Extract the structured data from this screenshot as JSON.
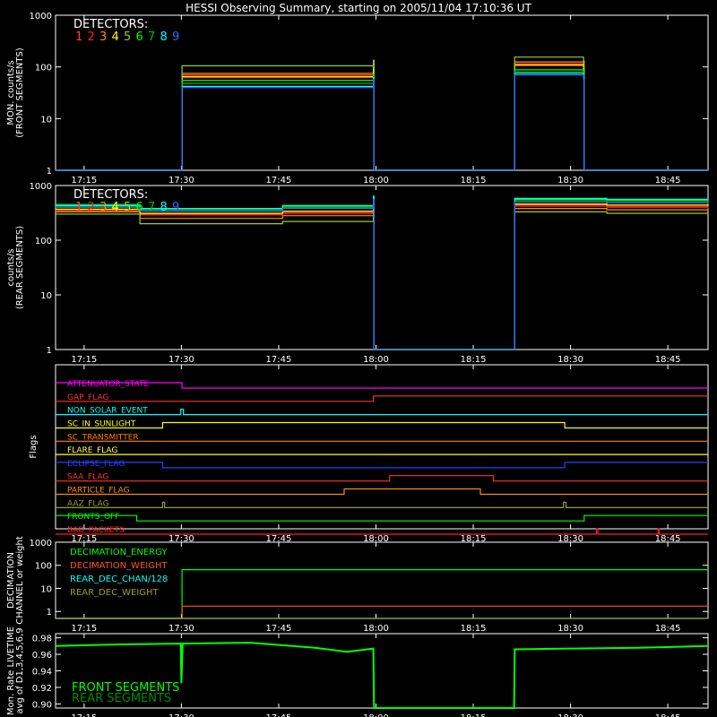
{
  "title": "HESSI Observing Summary, starting on 2005/11/04 17:10:36 UT",
  "time_ticks": [
    "17:15",
    "17:30",
    "17:45",
    "18:00",
    "18:15",
    "18:30",
    "18:45"
  ],
  "time_tick_minutes": [
    4.4,
    19.4,
    34.4,
    49.4,
    64.4,
    79.4,
    94.4
  ],
  "time_range_minutes": [
    0,
    100.6
  ],
  "detector_legend": {
    "label": "DETECTORS:",
    "numbers": [
      "1",
      "2",
      "3",
      "4",
      "5",
      "6",
      "7",
      "8",
      "9"
    ],
    "colors": [
      "#ff4040",
      "#ff2020",
      "#ff8c00",
      "#ffff00",
      "#9acd32",
      "#00ff00",
      "#00c000",
      "#00ffff",
      "#4060ff"
    ]
  },
  "chart_data": [
    {
      "type": "line",
      "panel": "front",
      "ylabel_lines": [
        "MON. counts/s",
        "(FRONT SEGMENTS)"
      ],
      "y_scale": "log",
      "ylim": [
        1,
        1000
      ],
      "yticks": [
        1,
        10,
        100,
        1000
      ],
      "ytick_labels": [
        "1",
        "10",
        "100",
        "1000"
      ],
      "x_minutes": [
        0,
        19.4,
        19.5,
        49.0,
        49.1,
        70.7,
        70.8,
        81.4,
        81.5,
        100.6
      ],
      "series": [
        {
          "name": "1",
          "color": "#ff4040",
          "values": [
            1,
            1,
            70,
            95,
            1,
            1,
            115,
            90,
            1,
            1
          ]
        },
        {
          "name": "2",
          "color": "#ff2020",
          "values": [
            1,
            1,
            62,
            88,
            1,
            1,
            105,
            85,
            1,
            1
          ]
        },
        {
          "name": "3",
          "color": "#ff8c00",
          "values": [
            1,
            1,
            75,
            100,
            1,
            1,
            125,
            95,
            1,
            1
          ]
        },
        {
          "name": "4",
          "color": "#ffff00",
          "values": [
            1,
            1,
            65,
            90,
            1,
            1,
            110,
            88,
            1,
            1
          ]
        },
        {
          "name": "5",
          "color": "#9acd32",
          "values": [
            1,
            1,
            105,
            135,
            1,
            1,
            155,
            130,
            1,
            1
          ]
        },
        {
          "name": "6",
          "color": "#00ff00",
          "values": [
            1,
            1,
            55,
            72,
            1,
            1,
            88,
            72,
            1,
            1
          ]
        },
        {
          "name": "7",
          "color": "#00c000",
          "values": [
            1,
            1,
            48,
            65,
            1,
            1,
            80,
            66,
            1,
            1
          ]
        },
        {
          "name": "8",
          "color": "#00ffff",
          "values": [
            1,
            1,
            42,
            62,
            1,
            1,
            75,
            62,
            1,
            1
          ]
        },
        {
          "name": "9",
          "color": "#4060ff",
          "values": [
            1,
            1,
            40,
            58,
            1,
            1,
            70,
            58,
            1,
            1
          ]
        }
      ]
    },
    {
      "type": "line",
      "panel": "rear",
      "ylabel_lines": [
        "counts/s",
        "(REAR SEGMENTS)"
      ],
      "y_scale": "log",
      "ylim": [
        1,
        1000
      ],
      "yticks": [
        1,
        10,
        100,
        1000
      ],
      "ytick_labels": [
        "1",
        "10",
        "100",
        "1000"
      ],
      "x_minutes": [
        0,
        13.0,
        35.0,
        49.0,
        49.1,
        70.7,
        70.8,
        85.0,
        100.6
      ],
      "series": [
        {
          "name": "1",
          "color": "#ff4040",
          "values": [
            360,
            300,
            320,
            480,
            1,
            1,
            440,
            420,
            400
          ]
        },
        {
          "name": "2",
          "color": "#ff2020",
          "values": [
            340,
            290,
            310,
            460,
            1,
            1,
            420,
            400,
            380
          ]
        },
        {
          "name": "3",
          "color": "#ff8c00",
          "values": [
            330,
            250,
            280,
            420,
            1,
            1,
            380,
            360,
            350
          ]
        },
        {
          "name": "4",
          "color": "#ffff00",
          "values": [
            370,
            310,
            340,
            500,
            1,
            1,
            460,
            440,
            420
          ]
        },
        {
          "name": "5",
          "color": "#9acd32",
          "values": [
            300,
            200,
            220,
            330,
            1,
            1,
            330,
            310,
            300
          ]
        },
        {
          "name": "6",
          "color": "#00ff00",
          "values": [
            450,
            380,
            420,
            620,
            1,
            1,
            560,
            540,
            520
          ]
        },
        {
          "name": "7",
          "color": "#00c000",
          "values": [
            420,
            360,
            400,
            600,
            1,
            1,
            530,
            510,
            500
          ]
        },
        {
          "name": "8",
          "color": "#00ffff",
          "values": [
            430,
            380,
            430,
            640,
            1,
            1,
            580,
            560,
            540
          ]
        },
        {
          "name": "9",
          "color": "#4060ff",
          "values": [
            400,
            340,
            380,
            560,
            1,
            1,
            500,
            480,
            460
          ]
        }
      ]
    },
    {
      "type": "flags",
      "panel": "flags",
      "ylabel": "Flags",
      "flags": [
        {
          "label": "ATTENUATOR_STATE",
          "color": "#ff00ff",
          "states": [
            [
              0,
              1
            ],
            [
              19.5,
              0
            ]
          ]
        },
        {
          "label": "GAP_FLAG",
          "color": "#ff3030",
          "states": [
            [
              0,
              0
            ],
            [
              49.0,
              1
            ]
          ]
        },
        {
          "label": "NON_SOLAR_EVENT",
          "color": "#00ffff",
          "states": [
            [
              0,
              0
            ],
            [
              19.3,
              1
            ],
            [
              19.7,
              0
            ]
          ]
        },
        {
          "label": "SC_IN_SUNLIGHT",
          "color": "#ffff00",
          "states": [
            [
              0,
              0
            ],
            [
              16.5,
              1
            ],
            [
              78.5,
              0
            ]
          ]
        },
        {
          "label": "SC_TRANSMITTER",
          "color": "#ff7f00",
          "states": [
            [
              0,
              0
            ]
          ]
        },
        {
          "label": "FLARE_FLAG",
          "color": "#ffff40",
          "states": [
            [
              0,
              0
            ]
          ]
        },
        {
          "label": "ECLIPSE_FLAG",
          "color": "#2040ff",
          "states": [
            [
              0,
              1
            ],
            [
              16.5,
              0
            ],
            [
              78.5,
              1
            ]
          ]
        },
        {
          "label": "SAA_FLAG",
          "color": "#ff3030",
          "states": [
            [
              0,
              0
            ],
            [
              51.5,
              1
            ],
            [
              67.5,
              0
            ]
          ]
        },
        {
          "label": "PARTICLE_FLAG",
          "color": "#ff8c00",
          "states": [
            [
              0,
              0
            ],
            [
              44.5,
              1
            ],
            [
              65.5,
              0
            ]
          ]
        },
        {
          "label": "AAZ_FLAG",
          "color": "#9a9a30",
          "states": [
            [
              0,
              0
            ],
            [
              16.5,
              1
            ],
            [
              16.8,
              0
            ],
            [
              78.3,
              1
            ],
            [
              78.7,
              0
            ]
          ]
        },
        {
          "label": "FRONTS_OFF",
          "color": "#00ff00",
          "states": [
            [
              0,
              1
            ],
            [
              12.5,
              0
            ],
            [
              81.5,
              1
            ]
          ]
        },
        {
          "label": "BAD_PACKETS",
          "color": "#ff2020",
          "states": [
            [
              0,
              0
            ],
            [
              83.4,
              1
            ],
            [
              83.6,
              0
            ],
            [
              92.9,
              1
            ],
            [
              93.1,
              0
            ]
          ]
        }
      ]
    },
    {
      "type": "line",
      "panel": "decimation",
      "ylabel_lines": [
        "DECIMATION",
        "CHANNEL or weight"
      ],
      "y_scale": "log",
      "ylim": [
        0.5,
        1000
      ],
      "yticks": [
        1,
        10,
        100,
        1000
      ],
      "ytick_labels": [
        "1",
        "10",
        "100",
        "1000"
      ],
      "legend": [
        {
          "name": "DECIMATION_ENERGY",
          "color": "#00ff00"
        },
        {
          "name": "DECIMATION_WEIGHT",
          "color": "#ff5030"
        },
        {
          "name": "REAR_DEC_CHAN/128",
          "color": "#00ffff"
        },
        {
          "name": "REAR_DEC_WEIGHT",
          "color": "#9a9a30"
        }
      ],
      "x_minutes": [
        0,
        19.4,
        19.5,
        100.6
      ],
      "series": [
        {
          "name": "DECIMATION_ENERGY",
          "color": "#00ff00",
          "values": [
            0.5,
            0.5,
            65,
            65
          ]
        },
        {
          "name": "DECIMATION_WEIGHT",
          "color": "#ff5030",
          "values": [
            0.5,
            0.5,
            1.7,
            1.7
          ]
        },
        {
          "name": "REAR_DEC_CHAN/128",
          "color": "#00ffff",
          "values": [
            0.5,
            0.5,
            0.5,
            0.5
          ]
        },
        {
          "name": "REAR_DEC_WEIGHT",
          "color": "#9a9a30",
          "values": [
            0.5,
            0.5,
            0.5,
            0.5
          ]
        }
      ]
    },
    {
      "type": "line",
      "panel": "livetime",
      "ylabel_lines": [
        "Mon. Rate LIVETIME",
        "avg of D1,3,4,5,6,9"
      ],
      "y_scale": "linear",
      "ylim": [
        0.895,
        0.985
      ],
      "yticks": [
        0.9,
        0.92,
        0.94,
        0.96,
        0.98
      ],
      "ytick_labels": [
        "0.90",
        "0.92",
        "0.94",
        "0.96",
        "0.98"
      ],
      "legend": [
        {
          "name": "FRONT SEGMENTS",
          "color": "#00ff00"
        },
        {
          "name": "REAR SEGMENTS",
          "color": "#008c00"
        }
      ],
      "x_minutes": [
        0,
        10,
        19.3,
        19.4,
        19.6,
        30,
        40,
        45,
        49.0,
        49.1,
        70.7,
        70.8,
        80,
        90,
        100.6
      ],
      "series": [
        {
          "name": "FRONT SEGMENTS",
          "color": "#00ff00",
          "values": [
            0.97,
            0.972,
            0.973,
            0.925,
            0.973,
            0.974,
            0.968,
            0.963,
            0.967,
            0.895,
            0.895,
            0.966,
            0.967,
            0.968,
            0.97
          ]
        }
      ]
    }
  ]
}
